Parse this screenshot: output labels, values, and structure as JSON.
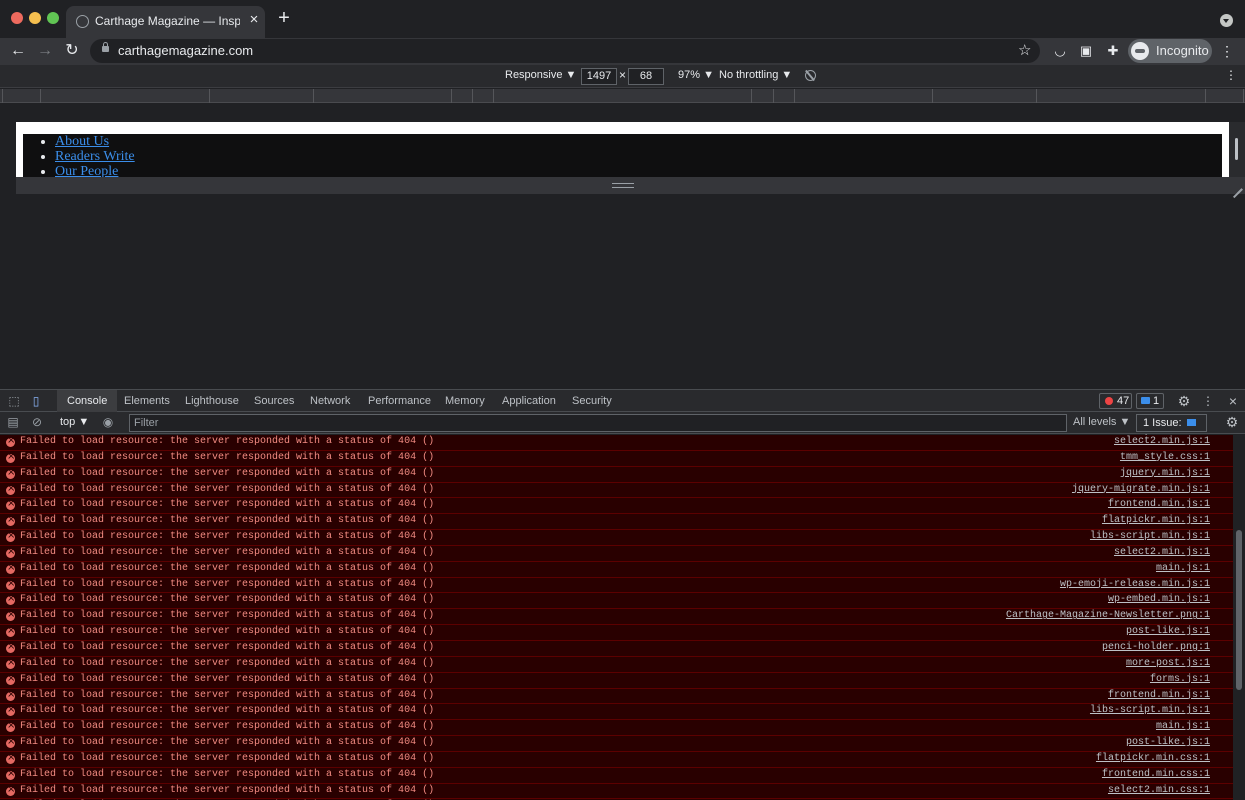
{
  "browser": {
    "tab_title": "Carthage Magazine — Inspiring",
    "url": "carthagemagazine.com",
    "profile_label": "Incognito"
  },
  "device_toolbar": {
    "mode": "Responsive ▼",
    "width": "1497",
    "height": "68",
    "zoom": "97% ▼",
    "throttling": "No throttling ▼"
  },
  "page": {
    "nav_links": [
      "About Us",
      "Readers Write",
      "Our People"
    ]
  },
  "devtools": {
    "tabs": [
      "Console",
      "Elements",
      "Lighthouse",
      "Sources",
      "Network",
      "Performance",
      "Memory",
      "Application",
      "Security"
    ],
    "active_tab": "Console",
    "error_count": "47",
    "message_count": "1",
    "context": "top ▼",
    "filter_placeholder": "Filter",
    "levels": "All levels ▼",
    "issues_label": "1 Issue:",
    "issues_count": "1"
  },
  "console": {
    "error_message": "Failed to load resource: the server responded with a status of 404 ()",
    "sources": [
      "select2.min.js:1",
      "tmm_style.css:1",
      "jquery.min.js:1",
      "jquery-migrate.min.js:1",
      "frontend.min.js:1",
      "flatpickr.min.js:1",
      "libs-script.min.js:1",
      "select2.min.js:1",
      "main.js:1",
      "wp-emoji-release.min.js:1",
      "wp-embed.min.js:1",
      "Carthage-Magazine-Newsletter.png:1",
      "post-like.js:1",
      "penci-holder.png:1",
      "more-post.js:1",
      "forms.js:1",
      "frontend.min.js:1",
      "libs-script.min.js:1",
      "main.js:1",
      "post-like.js:1",
      "flatpickr.min.css:1",
      "frontend.min.css:1",
      "select2.min.css:1",
      ""
    ]
  },
  "colors": {
    "error_bg": "#290000",
    "error_text": "#f28b82",
    "link": "#3b8eea"
  }
}
